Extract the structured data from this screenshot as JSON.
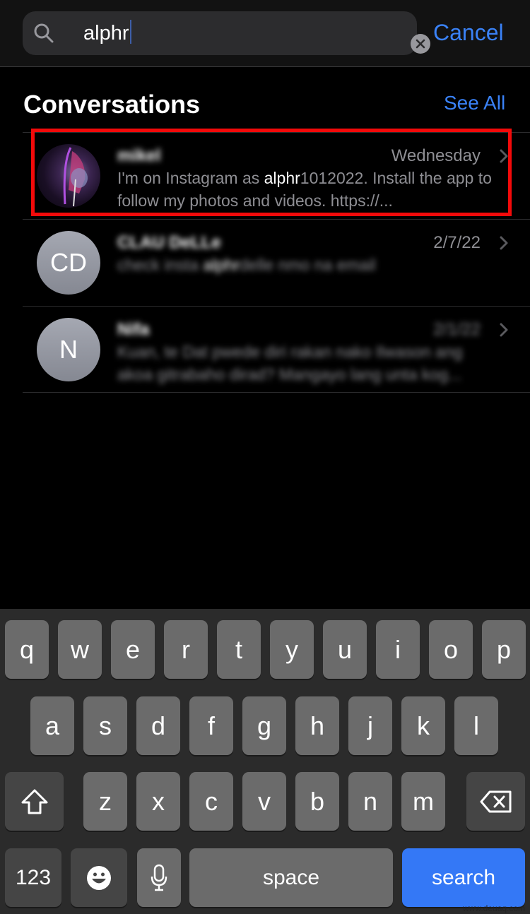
{
  "search": {
    "query": "alphr",
    "cancel_label": "Cancel"
  },
  "section": {
    "title": "Conversations",
    "see_all_label": "See All"
  },
  "conversations": [
    {
      "name": "mikel",
      "date": "Wednesday",
      "avatar": "photo",
      "preview_before": "I'm on Instagram as ",
      "preview_highlight": "alphr",
      "preview_after": "1012022. Install the app to follow my photos and videos. https://...",
      "highlighted": true
    },
    {
      "name": "CLAU DeLLe",
      "date": "2/7/22",
      "avatar_initials": "CD",
      "preview_before": "check insta ",
      "preview_highlight": "alphr",
      "preview_after": "delle nmo na email"
    },
    {
      "name": "Nifa",
      "date": "2/1/22",
      "avatar_initials": "N",
      "preview_before": "Kuan, te Dat pwede diri rakan nako Ilwason ang akoa gitrabaho dirad? Mangayo lang unta kog..."
    }
  ],
  "keyboard": {
    "row1": [
      "q",
      "w",
      "e",
      "r",
      "t",
      "y",
      "u",
      "i",
      "o",
      "p"
    ],
    "row2": [
      "a",
      "s",
      "d",
      "f",
      "g",
      "h",
      "j",
      "k",
      "l"
    ],
    "row3": [
      "z",
      "x",
      "c",
      "v",
      "b",
      "n",
      "m"
    ],
    "numbers_label": "123",
    "space_label": "space",
    "search_label": "search"
  },
  "watermark": "www.deuaq.com",
  "colors": {
    "accent": "#3a82f7",
    "highlight_box": "#f20a0a",
    "search_key": "#3478f6"
  }
}
